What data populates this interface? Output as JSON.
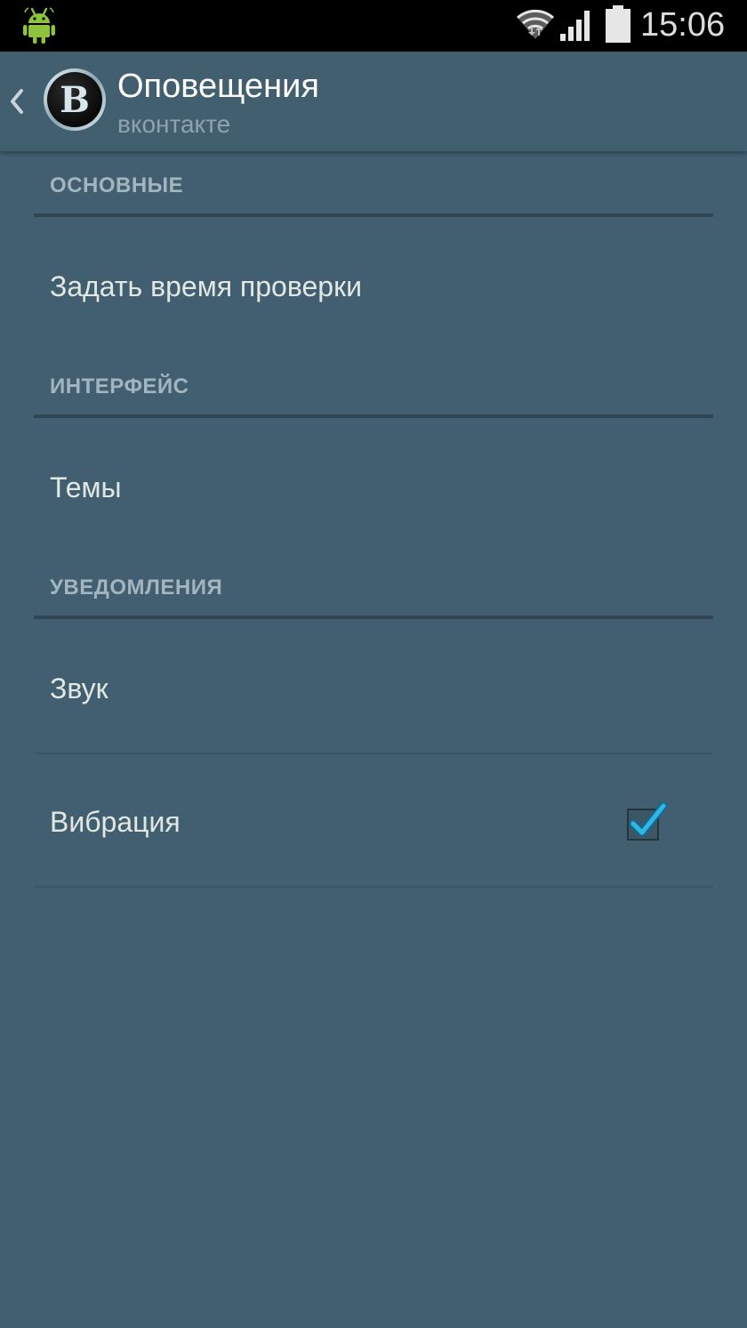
{
  "status_bar": {
    "time": "15:06",
    "icons": [
      "android-icon",
      "wifi-icon",
      "signal-icon",
      "battery-icon"
    ]
  },
  "action_bar": {
    "title": "Оповещения",
    "subtitle": "вконтакте",
    "logo_letter": "В",
    "icons": [
      "back-chevron-icon",
      "app-logo-icon"
    ]
  },
  "preferences": {
    "categories": [
      {
        "label": "ОСНОВНЫЕ",
        "items": [
          {
            "label": "Задать время проверки"
          }
        ]
      },
      {
        "label": "ИНТЕРФЕЙС",
        "items": [
          {
            "label": "Темы"
          }
        ]
      },
      {
        "label": "УВЕДОМЛЕНИЯ",
        "items": [
          {
            "label": "Звук"
          },
          {
            "label": "Вибрация",
            "checked": true
          }
        ]
      }
    ]
  },
  "colors": {
    "background": "#415f70",
    "status_bar": "#000000",
    "category_text": "#a3b5bf",
    "item_text": "#e2e8e1",
    "checkbox_accent": "#33b5e5"
  }
}
